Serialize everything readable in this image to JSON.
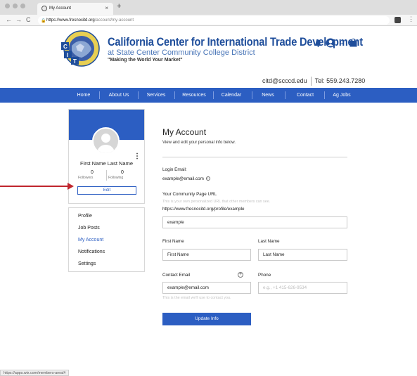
{
  "browser": {
    "tab_title": "My Account",
    "tab_close": "×",
    "new_tab": "+",
    "back": "←",
    "forward": "→",
    "reload": "C",
    "url_host": "https://www.fresnocitd.org",
    "url_path": "/account/my-account",
    "status_url": "https://apps.wix.com/members-area/#"
  },
  "header": {
    "title": "California Center for International Trade Development",
    "subtitle": "at State Center Community College District",
    "tagline": "\"Making the World Your Market\"",
    "email": "citd@scccd.edu",
    "phone": "Tel: 559.243.7280",
    "user_chevron": "⌄"
  },
  "nav": {
    "items": [
      "Home",
      "About Us",
      "Services",
      "Resources",
      "Calendar",
      "News",
      "Contact",
      "Ag Jobs"
    ]
  },
  "profile": {
    "name": "First Name Last Name",
    "followers_count": "0",
    "followers_label": "Followers",
    "following_count": "0",
    "following_label": "Following",
    "edit_label": "Edit",
    "more": "⋮"
  },
  "side_menu": {
    "items": [
      "Profile",
      "Job Posts",
      "My Account",
      "Notifications",
      "Settings"
    ],
    "active": "My Account"
  },
  "account": {
    "title": "My Account",
    "subtitle": "View and edit your personal info below.",
    "login_email_label": "Login Email:",
    "login_email": "example@email.com",
    "community_label": "Your Community Page URL",
    "community_hint": "This is your own personalized URL that other members can see.",
    "community_base": "https://www.fresnocitd.org/profile/example",
    "community_value": "example",
    "first_name_label": "First Name",
    "first_name_value": "First Name",
    "last_name_label": "Last Name",
    "last_name_value": "Last Name",
    "contact_email_label": "Contact Email",
    "contact_email_value": "example@email.com",
    "contact_email_hint": "This is the email we'll use to contact you.",
    "phone_label": "Phone",
    "phone_placeholder": "e.g., +1 415-626-9534",
    "update_label": "Update Info"
  },
  "colors": {
    "brand_blue": "#2c5ec2",
    "title_blue": "#1f4e9b",
    "arrow_red": "#c0262e"
  }
}
